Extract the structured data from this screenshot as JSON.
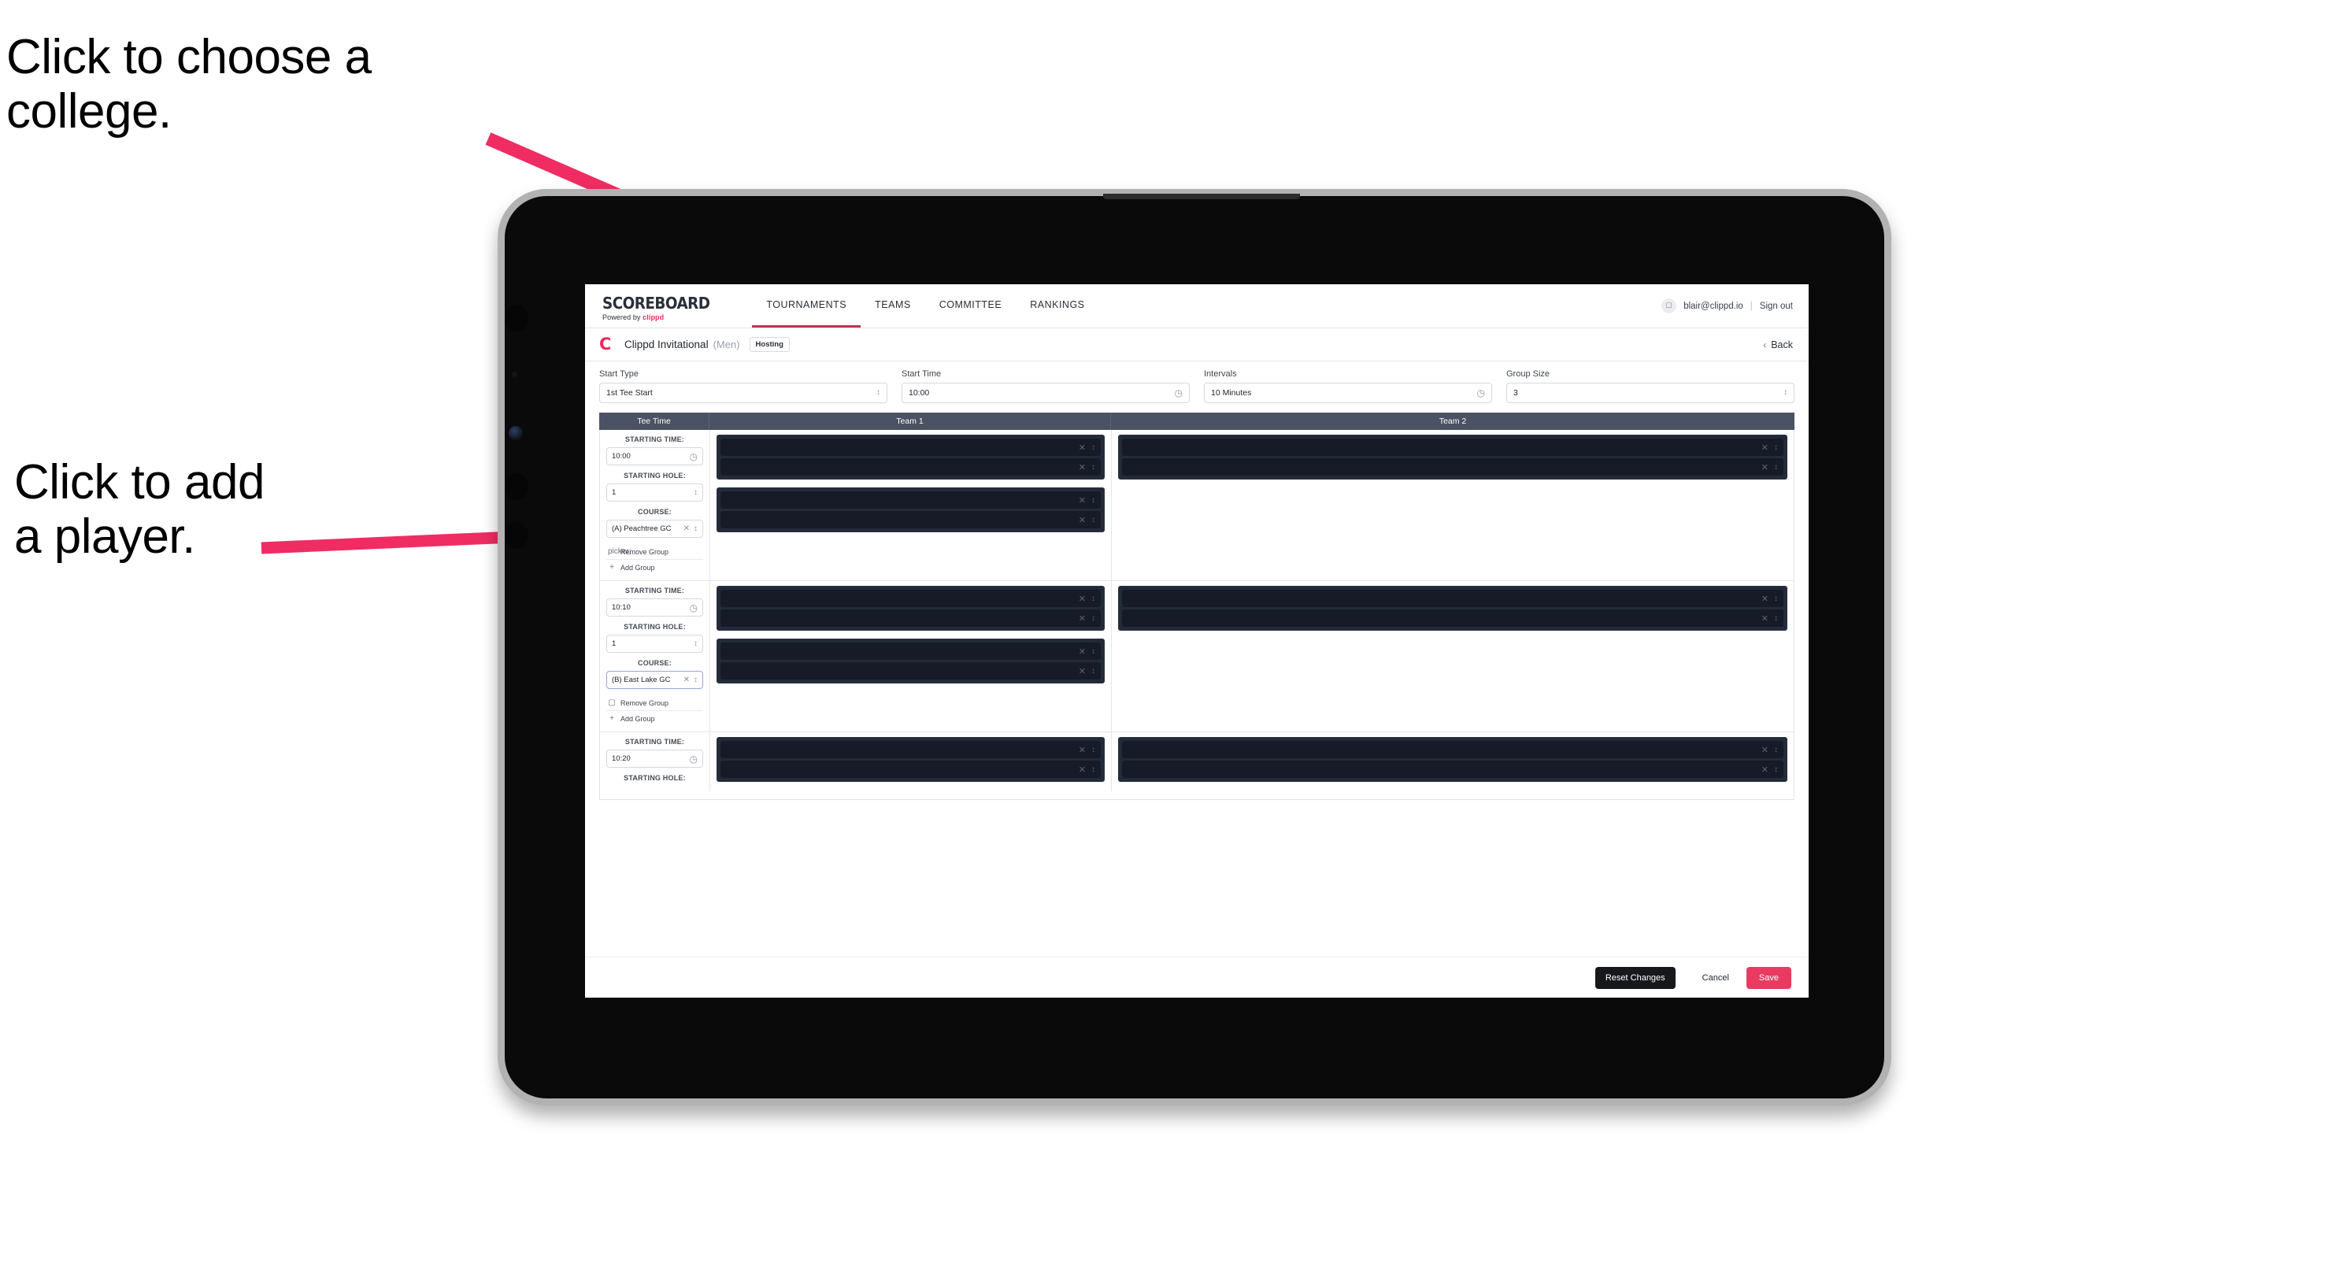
{
  "annotations": {
    "college": "Click to choose a\ncollege.",
    "player": "Click to add\na player.",
    "arrow_color": "#ef2d62"
  },
  "app": {
    "brand": {
      "title": "SCOREBOARD",
      "powered_by": "Powered by",
      "powered_by_brand": "clippd"
    },
    "nav": [
      {
        "label": "TOURNAMENTS",
        "active": true
      },
      {
        "label": "TEAMS",
        "active": false
      },
      {
        "label": "COMMITTEE",
        "active": false
      },
      {
        "label": "RANKINGS",
        "active": false
      }
    ],
    "account": {
      "avatar_icon": "user-icon",
      "email": "blair@clippd.io",
      "separator": "|",
      "sign_out": "Sign out"
    },
    "tournament": {
      "logo_letter": "C",
      "name": "Clippd Invitational",
      "gender": "(Men)",
      "status_chip": "Hosting",
      "back_chevron": "‹",
      "back_label": "Back"
    },
    "filters": [
      {
        "label": "Start Type",
        "value": "1st Tee Start",
        "control": "select"
      },
      {
        "label": "Start Time",
        "value": "10:00",
        "control": "time"
      },
      {
        "label": "Intervals",
        "value": "10 Minutes",
        "control": "time"
      },
      {
        "label": "Group Size",
        "value": "3",
        "control": "select"
      }
    ],
    "table": {
      "columns": [
        "Tee Time",
        "Team 1",
        "Team 2"
      ],
      "labels": {
        "starting_time": "STARTING TIME:",
        "starting_hole": "STARTING HOLE:",
        "course": "COURSE:",
        "remove_group": "Remove Group",
        "add_group": "Add Group",
        "remove_icon": "trash-icon",
        "add_icon": "plus-icon"
      },
      "groups": [
        {
          "starting_time": "10:00",
          "starting_hole": "1",
          "course": "(A) Peachtree GC",
          "course_focused": false,
          "team1_blocks": [
            2,
            2
          ],
          "team2_blocks": [
            2
          ]
        },
        {
          "starting_time": "10:10",
          "starting_hole": "1",
          "course": "(B) East Lake GC",
          "course_focused": true,
          "team1_blocks": [
            2,
            2
          ],
          "team2_blocks": [
            2
          ]
        },
        {
          "starting_time": "10:20",
          "starting_hole": "",
          "course": "",
          "course_focused": false,
          "team1_blocks": [
            2
          ],
          "team2_blocks": [
            2
          ],
          "partial": true
        }
      ]
    },
    "footer": {
      "reset": "Reset Changes",
      "cancel": "Cancel",
      "save": "Save"
    },
    "colors": {
      "accent_pink": "#ea3a62",
      "nav_active": "#c2344f",
      "table_header": "#4b5264",
      "dark_row": "#161b27"
    }
  }
}
